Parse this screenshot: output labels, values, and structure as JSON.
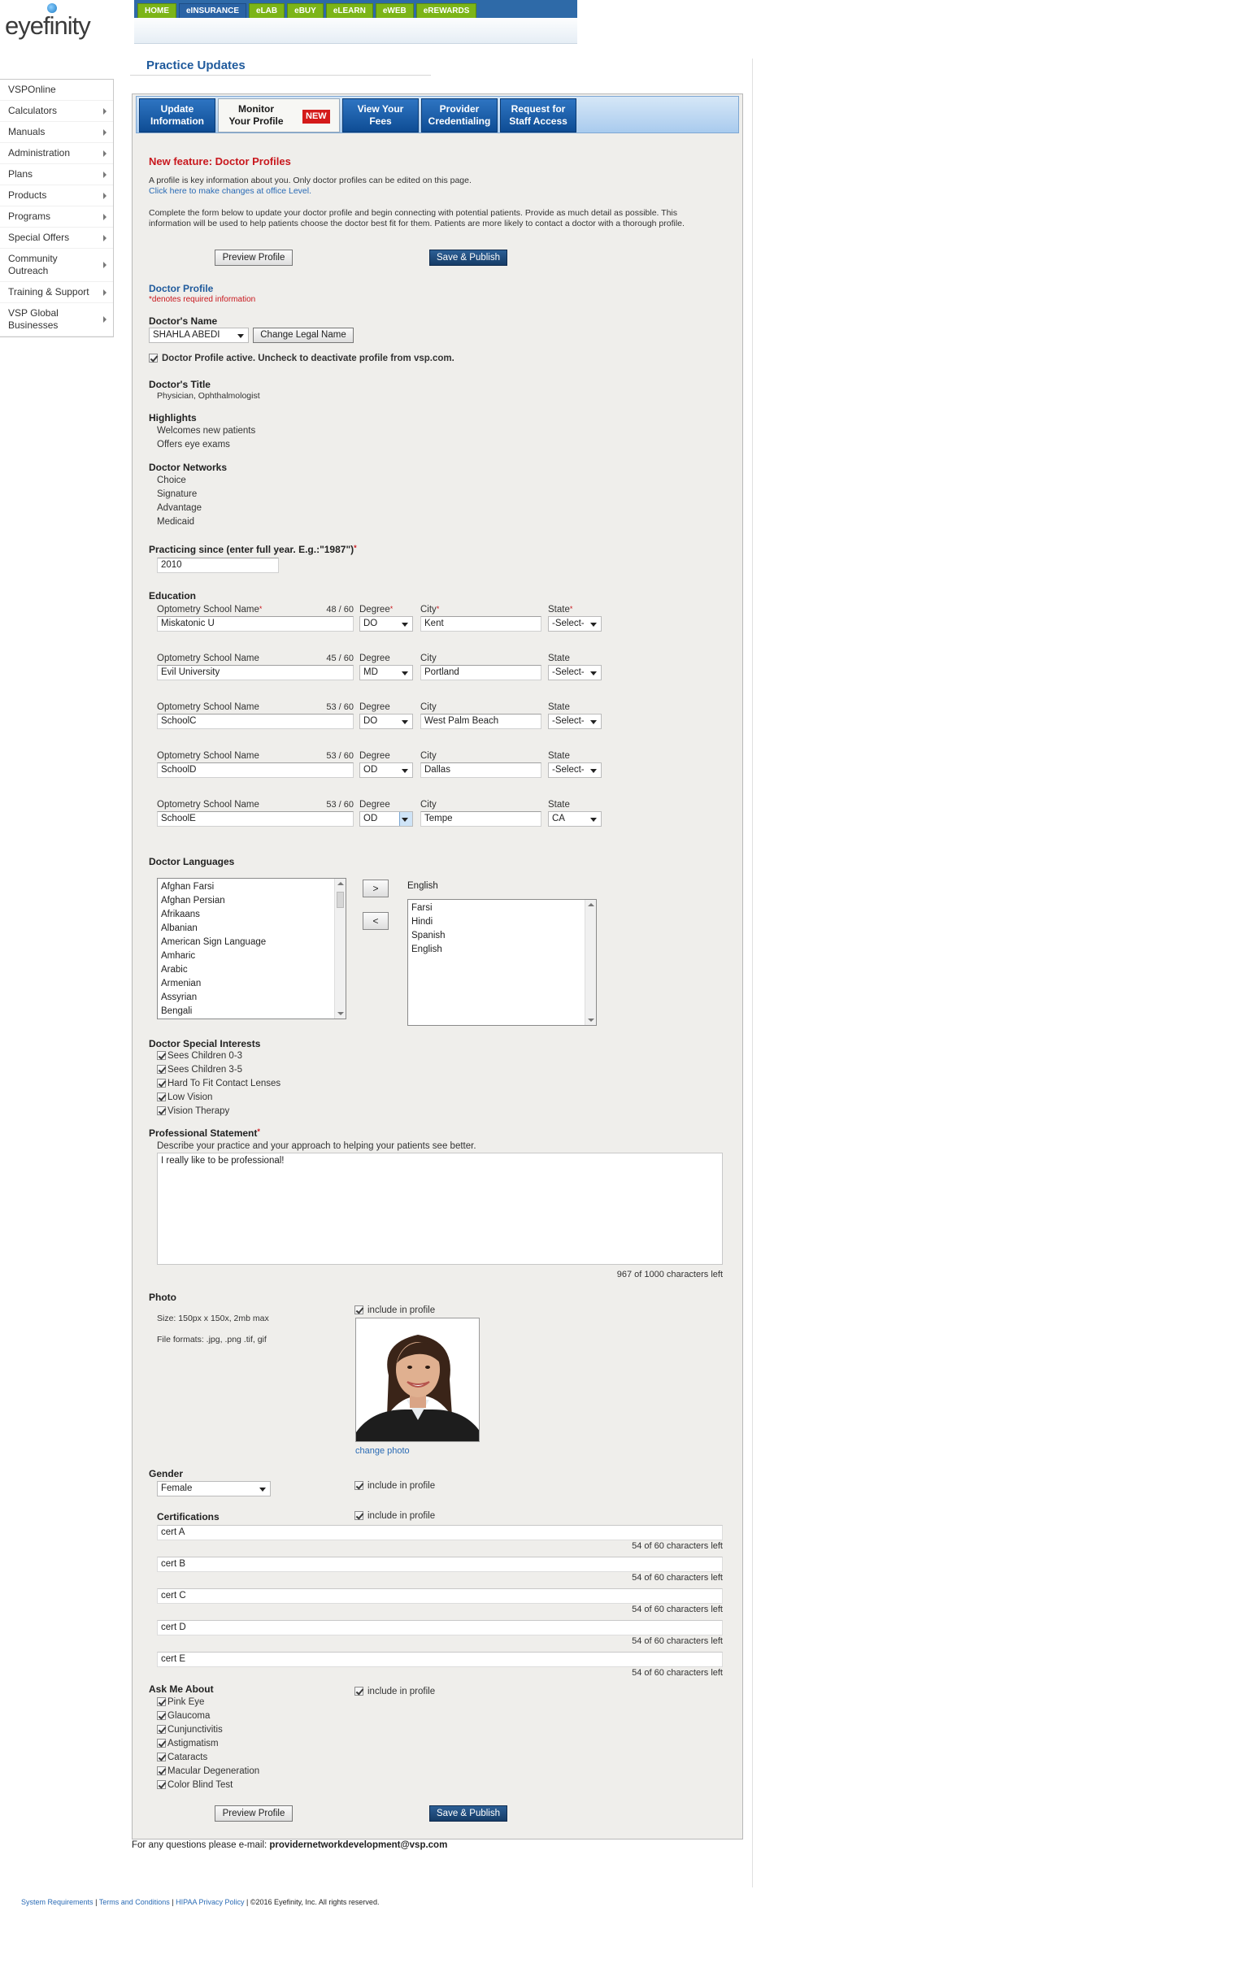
{
  "brand": {
    "logo_text": "eyefinity"
  },
  "top_nav": [
    "HOME",
    "eINSURANCE",
    "eLAB",
    "eBUY",
    "eLEARN",
    "eWEB",
    "eREWARDS"
  ],
  "top_nav_active": "eINSURANCE",
  "page_title": "Practice Updates",
  "sidebar": {
    "items": [
      {
        "label": "VSPOnline",
        "arrow": false
      },
      {
        "label": "Calculators",
        "arrow": true
      },
      {
        "label": "Manuals",
        "arrow": true
      },
      {
        "label": "Administration",
        "arrow": true
      },
      {
        "label": "Plans",
        "arrow": true
      },
      {
        "label": "Products",
        "arrow": true
      },
      {
        "label": "Programs",
        "arrow": true
      },
      {
        "label": "Special Offers",
        "arrow": true
      },
      {
        "label": "Community Outreach",
        "arrow": true
      },
      {
        "label": "Training & Support",
        "arrow": true
      },
      {
        "label": "VSP Global Businesses",
        "arrow": true
      }
    ]
  },
  "tabs": [
    {
      "label": "Update Information"
    },
    {
      "label": "Monitor Your Profile"
    },
    {
      "label": "View Your Fees"
    },
    {
      "label": "Provider Credentialing"
    },
    {
      "label": "Request for Staff Access"
    }
  ],
  "new_badge": "NEW",
  "intro": {
    "heading": "New feature: Doctor Profiles",
    "line1": "A profile is key information about you. Only doctor profiles can be edited on this page.",
    "link": "Click here to make changes at office Level.",
    "para": "Complete the form below to update your doctor profile and begin connecting with potential patients. Provide as much detail as possible. This information will be used to help patients choose the doctor best fit for them. Patients are more likely to contact a doctor with a thorough profile."
  },
  "buttons": {
    "preview": "Preview Profile",
    "save": "Save & Publish",
    "change_name": "Change Legal Name",
    "move_right": ">",
    "move_left": "<"
  },
  "profile": {
    "title": "Doctor Profile",
    "required_note": "*denotes required information",
    "name_label": "Doctor's Name",
    "name_value": "SHAHLA ABEDI",
    "active_label": "Doctor Profile active. Uncheck to deactivate profile from vsp.com.",
    "title_label": "Doctor's Title",
    "title_value": "Physician, Ophthalmologist",
    "highlights_label": "Highlights",
    "highlights": [
      "Welcomes new patients",
      "Offers eye exams"
    ],
    "networks_label": "Doctor Networks",
    "networks": [
      "Choice",
      "Signature",
      "Advantage",
      "Medicaid"
    ],
    "practicing_label": "Practicing since (enter full year. E.g.:\"1987\")",
    "practicing_value": "2010",
    "required_mark": "*"
  },
  "education": {
    "label": "Education",
    "col_school": "Optometry School Name",
    "col_degree": "Degree",
    "col_city": "City",
    "col_state": "State",
    "rows": [
      {
        "count": "48 / 60",
        "school": "Miskatonic U",
        "degree": "DO",
        "city": "Kent",
        "state": "-Select-"
      },
      {
        "count": "45 / 60",
        "school": "Evil University",
        "degree": "MD",
        "city": "Portland",
        "state": "-Select-"
      },
      {
        "count": "53 / 60",
        "school": "SchoolC",
        "degree": "DO",
        "city": "West Palm Beach",
        "state": "-Select-"
      },
      {
        "count": "53 / 60",
        "school": "SchoolD",
        "degree": "OD",
        "city": "Dallas",
        "state": "-Select-"
      },
      {
        "count": "53 / 60",
        "school": "SchoolE",
        "degree": "OD",
        "city": "Tempe",
        "state": "CA"
      }
    ]
  },
  "languages": {
    "label": "Doctor Languages",
    "available": [
      "Afghan Farsi",
      "Afghan Persian",
      "Afrikaans",
      "Albanian",
      "American Sign Language",
      "Amharic",
      "Arabic",
      "Armenian",
      "Assyrian",
      "Bengali"
    ],
    "primary": "English",
    "selected": [
      "Farsi",
      "Hindi",
      "Spanish",
      "English"
    ]
  },
  "interests": {
    "label": "Doctor Special Interests",
    "items": [
      "Sees Children 0-3",
      "Sees Children 3-5",
      "Hard To Fit Contact Lenses",
      "Low Vision",
      "Vision Therapy"
    ]
  },
  "statement": {
    "label": "Professional Statement",
    "hint": "Describe your practice and your approach to helping your patients see better.",
    "value": "I really like to be professional!",
    "remaining": "967 of 1000 characters left"
  },
  "photo": {
    "label": "Photo",
    "size_note": "Size: 150px x 150x, 2mb max",
    "formats_note": "File formats: .jpg, .png .tif, gif",
    "include": "include in profile",
    "change": "change photo"
  },
  "gender": {
    "label": "Gender",
    "value": "Female",
    "include": "include in profile"
  },
  "certifications": {
    "label": "Certifications",
    "include": "include in profile",
    "items": [
      {
        "value": "cert A",
        "remaining": "54 of 60 characters left"
      },
      {
        "value": "cert B",
        "remaining": "54 of 60 characters left"
      },
      {
        "value": "cert C",
        "remaining": "54 of 60 characters left"
      },
      {
        "value": "cert D",
        "remaining": "54 of 60 characters left"
      },
      {
        "value": "cert E",
        "remaining": "54 of 60 characters left"
      }
    ]
  },
  "ask_me": {
    "label": "Ask Me About",
    "include": "include in profile",
    "items": [
      "Pink Eye",
      "Glaucoma",
      "Cunjunctivitis",
      "Astigmatism",
      "Cataracts",
      "Macular Degeneration",
      "Color Blind Test"
    ]
  },
  "contact": {
    "prefix": "For any questions please e-mail:",
    "email": "providernetworkdevelopment@vsp.com"
  },
  "footer": {
    "sysreq": "System Requirements",
    "terms": "Terms and Conditions",
    "hipaa": "HIPAA Privacy Policy",
    "copyright": "©2016 Eyefinity, Inc. All rights reserved.",
    "sep": "|"
  }
}
